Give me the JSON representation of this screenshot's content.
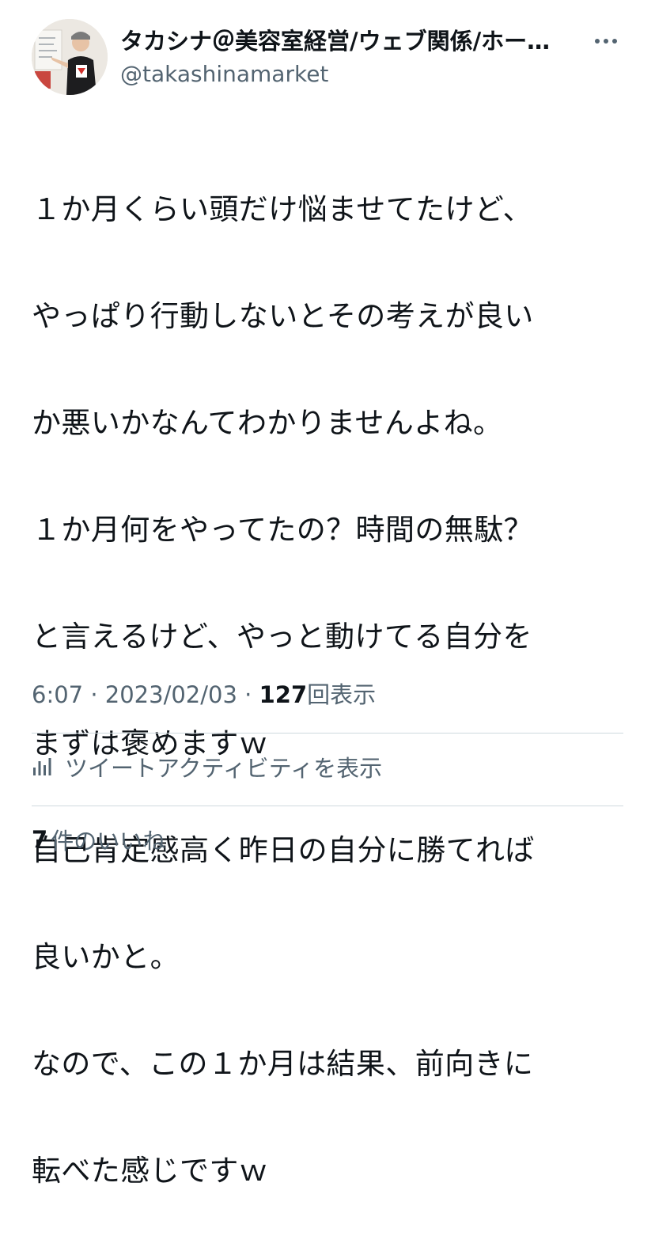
{
  "author": {
    "display_name": "タカシナ＠美容室経営/ウェブ関係/ホー…",
    "handle": "@takashinamarket"
  },
  "tweet": {
    "lines": [
      "１か月くらい頭だけ悩ませてたけど、",
      "やっぱり行動しないとその考えが良い",
      "か悪いかなんてわかりませんよね。",
      "１か月何をやってたの？時間の無駄？",
      "と言えるけど、やっと動けてる自分を",
      "まずは褒めますｗ",
      "自己肯定感高く昨日の自分に勝てれば",
      "良いかと。",
      "なので、この１か月は結果、前向きに",
      "転べた感じですｗ"
    ]
  },
  "meta": {
    "time": "6:07",
    "separator": " · ",
    "date": "2023/02/03",
    "views_count": "127",
    "views_label": "回表示"
  },
  "activity": {
    "label": "ツイートアクティビティを表示",
    "icon": "analytics-icon"
  },
  "likes": {
    "count": "7",
    "label": "件のいいね"
  },
  "more_icon": "more-dots-icon",
  "colors": {
    "text": "#0f1419",
    "secondary": "#536471",
    "divider": "#cfd9de"
  }
}
